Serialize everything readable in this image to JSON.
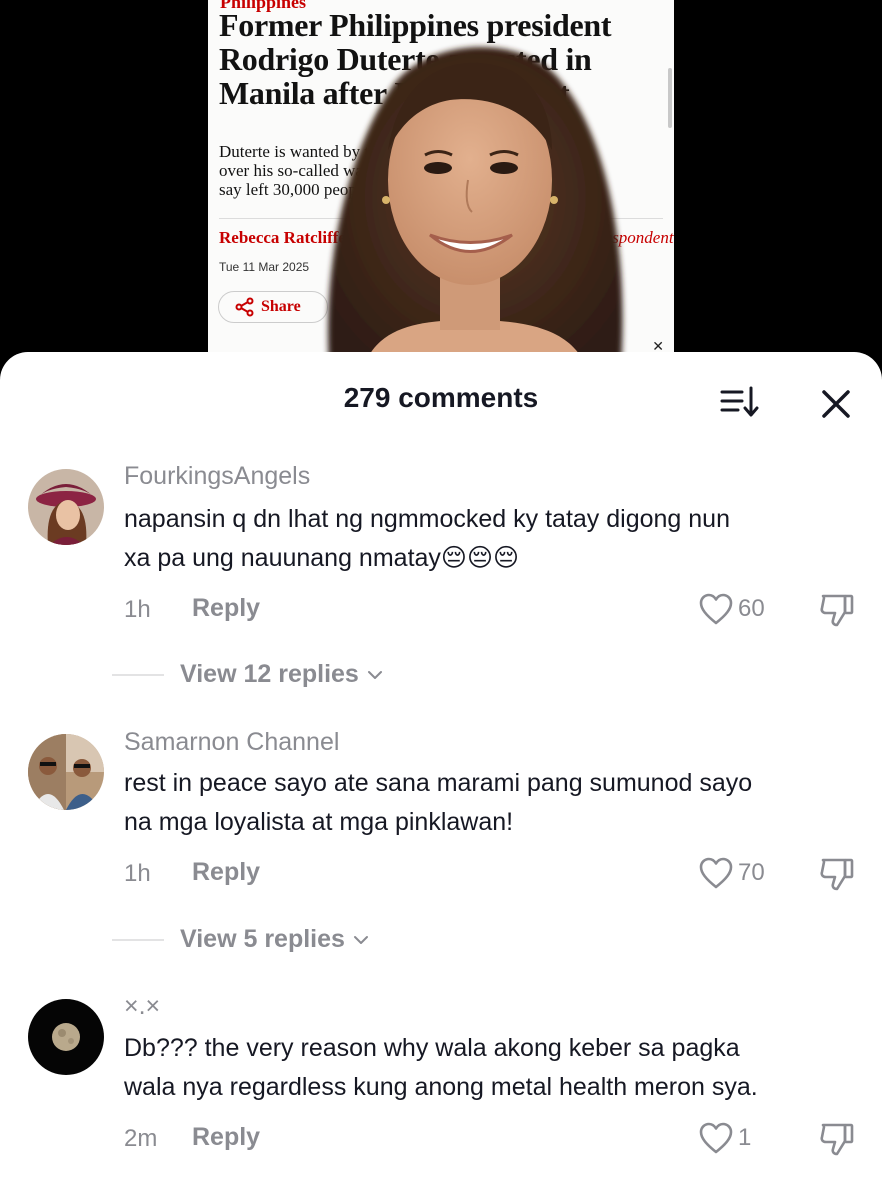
{
  "article": {
    "section": "Philippines",
    "headline_lines": [
      "Former Philippines president",
      "Rodrigo Duterte arrested in",
      "Manila after ICC warrant"
    ],
    "standfirst_lines": [
      "Duterte is wanted by the international court",
      "over his so-called war on drugs, which rights groups",
      "say left 30,000 people dead"
    ],
    "byline": "Rebecca Ratcliffe",
    "byline_role": "correspondent",
    "date": "Tue 11 Mar 2025",
    "share_label": "Share"
  },
  "sheet": {
    "title": "279 comments",
    "icons": {
      "sort": "sort-icon",
      "close": "close-icon"
    }
  },
  "comments": [
    {
      "username": "FourkingsAngels",
      "text_lines": [
        "napansin q dn lhat ng ngmmocked ky tatay digong nun",
        "xa pa ung nauunang nmatay😔😔😔"
      ],
      "time": "1h",
      "reply_label": "Reply",
      "likes": "60",
      "view_replies": "View 12 replies"
    },
    {
      "username": "Samarnon Channel",
      "text_lines": [
        "rest in peace sayo ate sana marami pang sumunod sayo",
        "na mga loyalista at mga pinklawan!"
      ],
      "time": "1h",
      "reply_label": "Reply",
      "likes": "70",
      "view_replies": "View 5 replies"
    },
    {
      "username": "×.×",
      "text_lines": [
        "Db??? the very reason why wala akong keber sa pagka",
        "wala nya regardless kung anong metal health meron sya."
      ],
      "time": "2m",
      "reply_label": "Reply",
      "likes": "1"
    }
  ],
  "colors": {
    "brand_red": "#c70000",
    "text_primary": "#161823",
    "text_secondary": "#8a8b91"
  }
}
